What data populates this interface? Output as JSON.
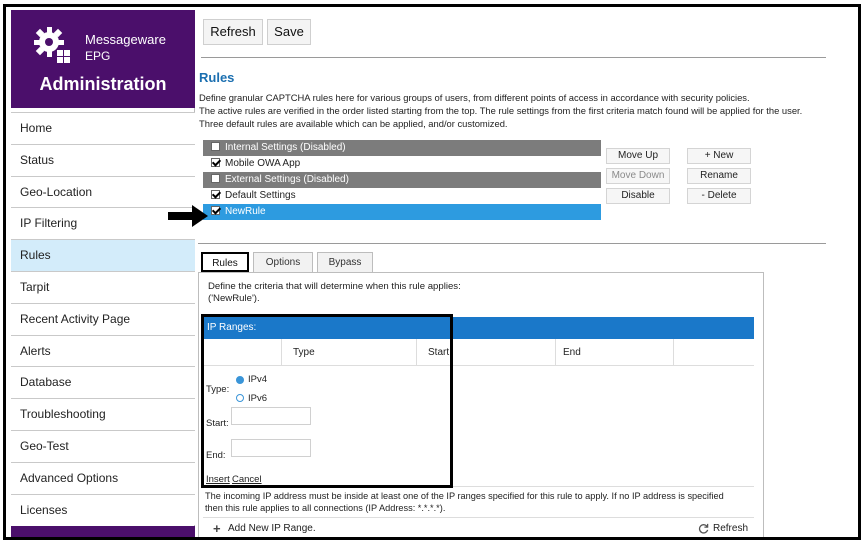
{
  "sidebar": {
    "product_line1": "Messageware",
    "product_line2": "EPG",
    "admin_title": "Administration",
    "items": [
      {
        "label": "Home",
        "active": false
      },
      {
        "label": "Status",
        "active": false
      },
      {
        "label": "Geo-Location",
        "active": false
      },
      {
        "label": "IP Filtering",
        "active": false
      },
      {
        "label": "Rules",
        "active": true
      },
      {
        "label": "Tarpit",
        "active": false
      },
      {
        "label": "Recent Activity Page",
        "active": false
      },
      {
        "label": "Alerts",
        "active": false
      },
      {
        "label": "Database",
        "active": false
      },
      {
        "label": "Troubleshooting",
        "active": false
      },
      {
        "label": "Geo-Test",
        "active": false
      },
      {
        "label": "Advanced Options",
        "active": false
      },
      {
        "label": "Licenses",
        "active": false
      }
    ]
  },
  "toolbar": {
    "refresh_label": "Refresh",
    "save_label": "Save"
  },
  "rules_section": {
    "heading": "Rules",
    "desc_line1": "Define granular CAPTCHA rules here for various groups of users, from different points of access in accordance with security policies.",
    "desc_line2": "The active rules are verified in the order listed starting from the top. The rule settings from the first criteria match found will be applied for the user.",
    "desc_line3": "Three default rules are available which can be applied, and/or customized.",
    "rules": [
      {
        "label": "Internal Settings (Disabled)",
        "checked": false,
        "state": "disabled"
      },
      {
        "label": "Mobile OWA App",
        "checked": true,
        "state": "normal"
      },
      {
        "label": "External Settings (Disabled)",
        "checked": false,
        "state": "disabled"
      },
      {
        "label": "Default Settings",
        "checked": true,
        "state": "normal"
      },
      {
        "label": "NewRule",
        "checked": true,
        "state": "selected"
      }
    ],
    "buttons": {
      "move_up": "Move Up",
      "move_down": "Move Down",
      "disable": "Disable",
      "new": "+ New",
      "rename": "Rename",
      "delete": "- Delete"
    }
  },
  "tabs": {
    "rules": "Rules",
    "options": "Options",
    "bypass": "Bypass",
    "active": "Rules"
  },
  "rule_panel": {
    "define_line1": "Define the criteria that will determine when this rule applies:",
    "define_line2": "('NewRule').",
    "ip_ranges_title": "IP Ranges:",
    "columns": {
      "type": "Type",
      "start": "Start",
      "end": "End"
    },
    "type_label": "Type:",
    "ipv4_label": "IPv4",
    "ipv6_label": "IPv6",
    "ip_version_selected": "IPv4",
    "start_label": "Start:",
    "end_label": "End:",
    "start_value": "",
    "end_value": "",
    "insert_link": "Insert",
    "cancel_link": "Cancel",
    "note_line1": "The incoming IP address must be inside at least one of the IP ranges specified for this rule to apply. If no IP address is specified",
    "note_line2": "then this rule applies to all connections (IP Address: *.*.*.*).",
    "add_range_label": "Add New IP Range.",
    "refresh_label": "Refresh"
  },
  "colors": {
    "brand_purple": "#4b0f6b",
    "accent_blue": "#1a78c9",
    "selected_blue": "#2d9be0",
    "disabled_gray": "#7c7c7c",
    "active_nav": "#d3ecfa"
  }
}
